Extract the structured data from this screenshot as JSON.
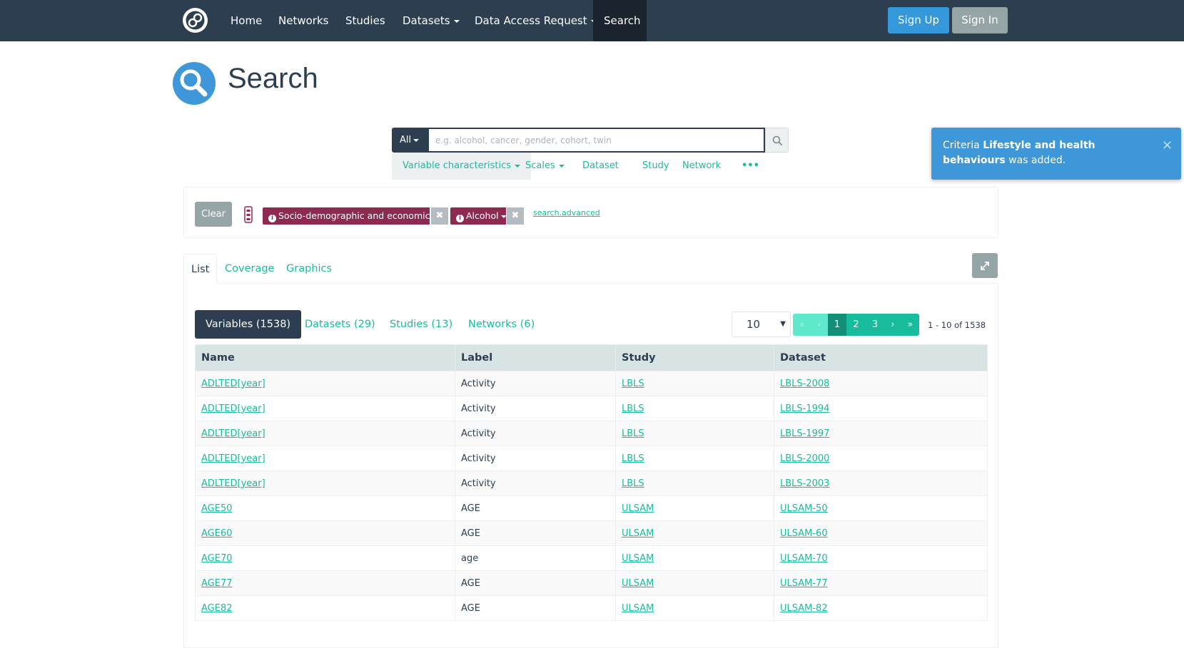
{
  "nav": {
    "items": [
      {
        "label": "Home"
      },
      {
        "label": "Networks"
      },
      {
        "label": "Studies"
      },
      {
        "label": "Datasets"
      },
      {
        "label": "Data Access Request"
      },
      {
        "label": "Search"
      }
    ],
    "signup_label": "Sign Up",
    "signin_label": "Sign In",
    "active": "Search"
  },
  "page": {
    "title": "Search"
  },
  "search": {
    "scope_label": "All",
    "placeholder": "e.g. alcohol, cancer, gender, cohort, twin",
    "filters": [
      {
        "label": "Variable characteristics"
      },
      {
        "label": "Scales"
      },
      {
        "label": "Dataset"
      },
      {
        "label": "Study"
      },
      {
        "label": "Network"
      },
      {
        "label": "•••"
      }
    ]
  },
  "toast": {
    "prefix": "Criteria ",
    "bold": "Lifestyle and health behaviours",
    "suffix": " was added.",
    "close": "×"
  },
  "criteria": {
    "clear_label": "Clear",
    "chips": [
      {
        "label": "Socio-demographic and economic..."
      },
      {
        "label": "Alcohol"
      }
    ],
    "remove_glyph": "✖",
    "advanced_label": "search.advanced"
  },
  "result_tabs": [
    {
      "label": "List"
    },
    {
      "label": "Coverage"
    },
    {
      "label": "Graphics"
    }
  ],
  "entities": [
    {
      "label": "Variables (1538)"
    },
    {
      "label": "Datasets (29)"
    },
    {
      "label": "Studies (13)"
    },
    {
      "label": "Networks (6)"
    }
  ],
  "pagination": {
    "page_size": "10",
    "first": "«",
    "prev": "‹",
    "pages": [
      "1",
      "2",
      "3"
    ],
    "next": "›",
    "last": "»",
    "info": "1 - 10 of 1538"
  },
  "table": {
    "headers": [
      "Name",
      "Label",
      "Study",
      "Dataset"
    ],
    "rows": [
      {
        "name": "ADLTED[year]",
        "label": "Activity",
        "study": "LBLS",
        "dataset": "LBLS-2008"
      },
      {
        "name": "ADLTED[year]",
        "label": "Activity",
        "study": "LBLS",
        "dataset": "LBLS-1994"
      },
      {
        "name": "ADLTED[year]",
        "label": "Activity",
        "study": "LBLS",
        "dataset": "LBLS-1997"
      },
      {
        "name": "ADLTED[year]",
        "label": "Activity",
        "study": "LBLS",
        "dataset": "LBLS-2000"
      },
      {
        "name": "ADLTED[year]",
        "label": "Activity",
        "study": "LBLS",
        "dataset": "LBLS-2003"
      },
      {
        "name": "AGE50",
        "label": "AGE",
        "study": "ULSAM",
        "dataset": "ULSAM-50"
      },
      {
        "name": "AGE60",
        "label": "AGE",
        "study": "ULSAM",
        "dataset": "ULSAM-60"
      },
      {
        "name": "AGE70",
        "label": "age",
        "study": "ULSAM",
        "dataset": "ULSAM-70"
      },
      {
        "name": "AGE77",
        "label": "AGE",
        "study": "ULSAM",
        "dataset": "ULSAM-77"
      },
      {
        "name": "AGE82",
        "label": "AGE",
        "study": "ULSAM",
        "dataset": "ULSAM-82"
      }
    ]
  },
  "colors": {
    "navbar": "#2c3e50",
    "accent": "#18bc9c",
    "primary": "#3498db",
    "chip": "#8e2a52"
  },
  "icons": {
    "brand": "brand-logo-icon",
    "title": "search-magnifier-icon",
    "search_button": "search-icon",
    "expand": "expand-arrows-icon",
    "criteria": "criteria-list-icon",
    "chip_info": "info-circle-icon"
  }
}
